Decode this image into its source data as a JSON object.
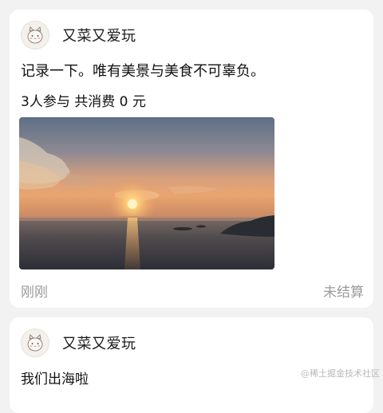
{
  "posts": [
    {
      "username": "又菜又爱玩",
      "text": "记录一下。唯有美景与美食不可辜负。",
      "summary": "3人参与 共消费 0 元",
      "time": "刚刚",
      "status": "未结算",
      "avatar_icon": "cat-face-icon",
      "photo_subject": "sunset-over-sea"
    },
    {
      "username": "又菜又爱玩",
      "text": "我们出海啦",
      "avatar_icon": "cat-face-icon"
    }
  ],
  "watermark": "@稀土掘金技术社区"
}
